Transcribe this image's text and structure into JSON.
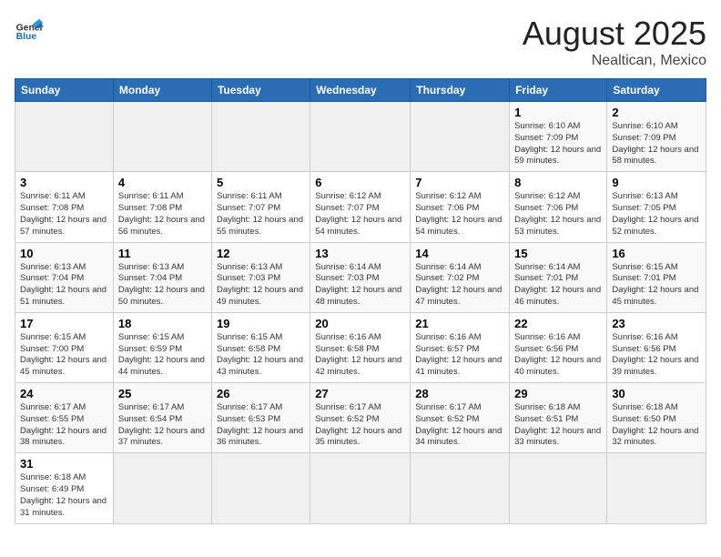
{
  "header": {
    "logo_general": "General",
    "logo_blue": "Blue",
    "month_year": "August 2025",
    "location": "Nealtican, Mexico"
  },
  "days_of_week": [
    "Sunday",
    "Monday",
    "Tuesday",
    "Wednesday",
    "Thursday",
    "Friday",
    "Saturday"
  ],
  "weeks": [
    [
      {
        "day": "",
        "info": ""
      },
      {
        "day": "",
        "info": ""
      },
      {
        "day": "",
        "info": ""
      },
      {
        "day": "",
        "info": ""
      },
      {
        "day": "",
        "info": ""
      },
      {
        "day": "1",
        "info": "Sunrise: 6:10 AM\nSunset: 7:09 PM\nDaylight: 12 hours and 59 minutes."
      },
      {
        "day": "2",
        "info": "Sunrise: 6:10 AM\nSunset: 7:09 PM\nDaylight: 12 hours and 58 minutes."
      }
    ],
    [
      {
        "day": "3",
        "info": "Sunrise: 6:11 AM\nSunset: 7:08 PM\nDaylight: 12 hours and 57 minutes."
      },
      {
        "day": "4",
        "info": "Sunrise: 6:11 AM\nSunset: 7:08 PM\nDaylight: 12 hours and 56 minutes."
      },
      {
        "day": "5",
        "info": "Sunrise: 6:11 AM\nSunset: 7:07 PM\nDaylight: 12 hours and 55 minutes."
      },
      {
        "day": "6",
        "info": "Sunrise: 6:12 AM\nSunset: 7:07 PM\nDaylight: 12 hours and 54 minutes."
      },
      {
        "day": "7",
        "info": "Sunrise: 6:12 AM\nSunset: 7:06 PM\nDaylight: 12 hours and 54 minutes."
      },
      {
        "day": "8",
        "info": "Sunrise: 6:12 AM\nSunset: 7:06 PM\nDaylight: 12 hours and 53 minutes."
      },
      {
        "day": "9",
        "info": "Sunrise: 6:13 AM\nSunset: 7:05 PM\nDaylight: 12 hours and 52 minutes."
      }
    ],
    [
      {
        "day": "10",
        "info": "Sunrise: 6:13 AM\nSunset: 7:04 PM\nDaylight: 12 hours and 51 minutes."
      },
      {
        "day": "11",
        "info": "Sunrise: 6:13 AM\nSunset: 7:04 PM\nDaylight: 12 hours and 50 minutes."
      },
      {
        "day": "12",
        "info": "Sunrise: 6:13 AM\nSunset: 7:03 PM\nDaylight: 12 hours and 49 minutes."
      },
      {
        "day": "13",
        "info": "Sunrise: 6:14 AM\nSunset: 7:03 PM\nDaylight: 12 hours and 48 minutes."
      },
      {
        "day": "14",
        "info": "Sunrise: 6:14 AM\nSunset: 7:02 PM\nDaylight: 12 hours and 47 minutes."
      },
      {
        "day": "15",
        "info": "Sunrise: 6:14 AM\nSunset: 7:01 PM\nDaylight: 12 hours and 46 minutes."
      },
      {
        "day": "16",
        "info": "Sunrise: 6:15 AM\nSunset: 7:01 PM\nDaylight: 12 hours and 45 minutes."
      }
    ],
    [
      {
        "day": "17",
        "info": "Sunrise: 6:15 AM\nSunset: 7:00 PM\nDaylight: 12 hours and 45 minutes."
      },
      {
        "day": "18",
        "info": "Sunrise: 6:15 AM\nSunset: 6:59 PM\nDaylight: 12 hours and 44 minutes."
      },
      {
        "day": "19",
        "info": "Sunrise: 6:15 AM\nSunset: 6:58 PM\nDaylight: 12 hours and 43 minutes."
      },
      {
        "day": "20",
        "info": "Sunrise: 6:16 AM\nSunset: 6:58 PM\nDaylight: 12 hours and 42 minutes."
      },
      {
        "day": "21",
        "info": "Sunrise: 6:16 AM\nSunset: 6:57 PM\nDaylight: 12 hours and 41 minutes."
      },
      {
        "day": "22",
        "info": "Sunrise: 6:16 AM\nSunset: 6:56 PM\nDaylight: 12 hours and 40 minutes."
      },
      {
        "day": "23",
        "info": "Sunrise: 6:16 AM\nSunset: 6:56 PM\nDaylight: 12 hours and 39 minutes."
      }
    ],
    [
      {
        "day": "24",
        "info": "Sunrise: 6:17 AM\nSunset: 6:55 PM\nDaylight: 12 hours and 38 minutes."
      },
      {
        "day": "25",
        "info": "Sunrise: 6:17 AM\nSunset: 6:54 PM\nDaylight: 12 hours and 37 minutes."
      },
      {
        "day": "26",
        "info": "Sunrise: 6:17 AM\nSunset: 6:53 PM\nDaylight: 12 hours and 36 minutes."
      },
      {
        "day": "27",
        "info": "Sunrise: 6:17 AM\nSunset: 6:52 PM\nDaylight: 12 hours and 35 minutes."
      },
      {
        "day": "28",
        "info": "Sunrise: 6:17 AM\nSunset: 6:52 PM\nDaylight: 12 hours and 34 minutes."
      },
      {
        "day": "29",
        "info": "Sunrise: 6:18 AM\nSunset: 6:51 PM\nDaylight: 12 hours and 33 minutes."
      },
      {
        "day": "30",
        "info": "Sunrise: 6:18 AM\nSunset: 6:50 PM\nDaylight: 12 hours and 32 minutes."
      }
    ],
    [
      {
        "day": "31",
        "info": "Sunrise: 6:18 AM\nSunset: 6:49 PM\nDaylight: 12 hours and 31 minutes."
      },
      {
        "day": "",
        "info": ""
      },
      {
        "day": "",
        "info": ""
      },
      {
        "day": "",
        "info": ""
      },
      {
        "day": "",
        "info": ""
      },
      {
        "day": "",
        "info": ""
      },
      {
        "day": "",
        "info": ""
      }
    ]
  ]
}
